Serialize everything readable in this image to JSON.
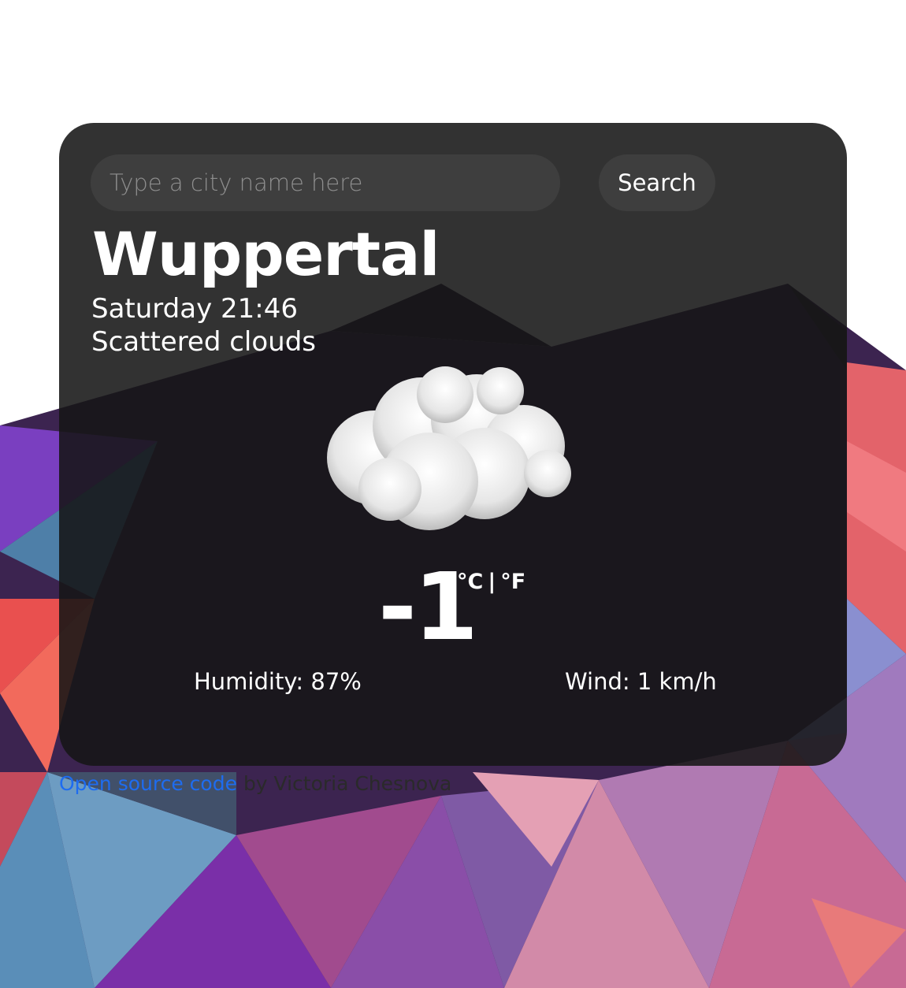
{
  "search": {
    "placeholder": "Type a city name here",
    "button_label": "Search"
  },
  "weather": {
    "city": "Wuppertal",
    "day_time": "Saturday 21:46",
    "description": "Scattered clouds",
    "icon": "cloud-icon",
    "temperature": "-1",
    "unit_celsius": "°C",
    "unit_separator": "|",
    "unit_fahrenheit": "°F",
    "humidity": "Humidity: 87%",
    "wind": "Wind: 1 km/h"
  },
  "footer": {
    "link_text": "Open source code",
    "by_text": "by Victoria Chesnova"
  }
}
